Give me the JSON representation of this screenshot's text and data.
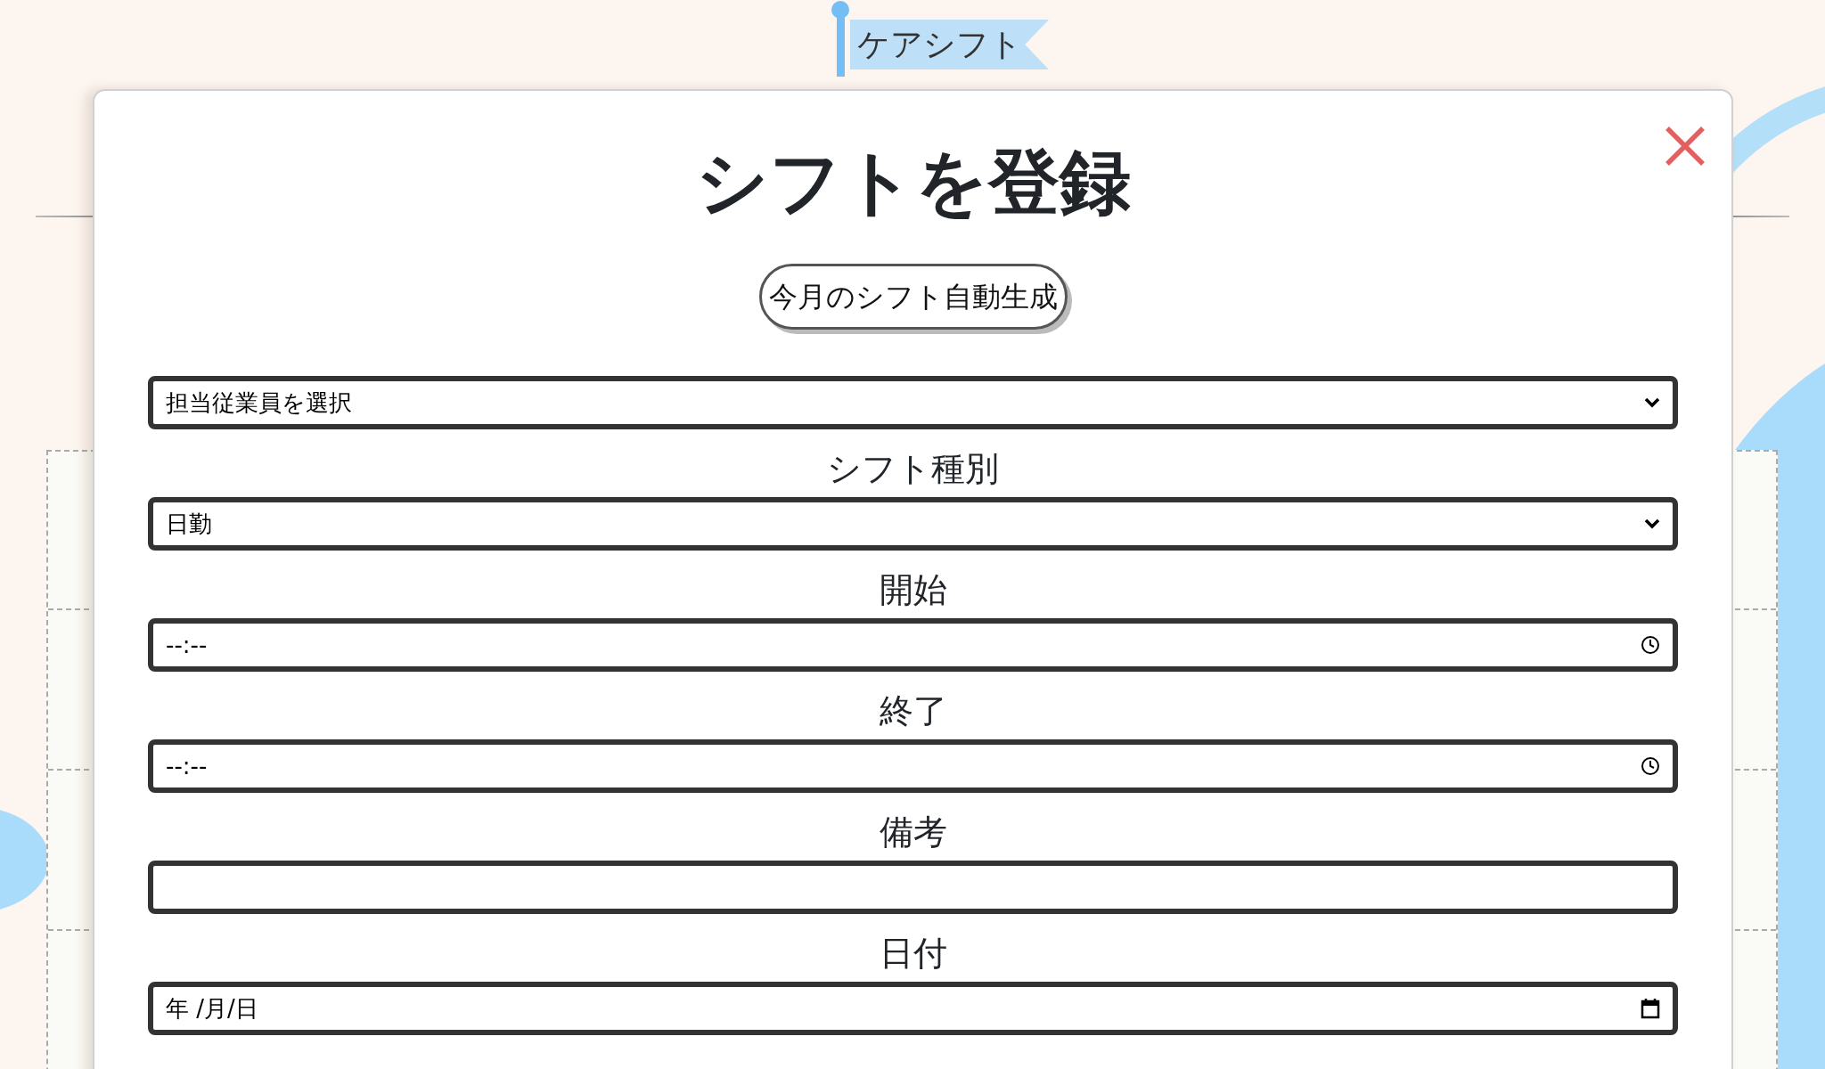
{
  "logo": {
    "text": "ケアシフト"
  },
  "modal": {
    "title": "シフトを登録",
    "auto_generate_button": "今月のシフト自動生成",
    "fields": [
      {
        "kind": "select",
        "value": "担当従業員を選択"
      },
      {
        "kind": "select",
        "label": "シフト種別",
        "value": "日勤"
      },
      {
        "kind": "time",
        "label": "開始",
        "placeholder": "--:--"
      },
      {
        "kind": "time",
        "label": "終了",
        "placeholder": "--:--"
      },
      {
        "kind": "text",
        "label": "備考"
      },
      {
        "kind": "date",
        "label": "日付",
        "placeholder": "年 /月/日"
      }
    ]
  }
}
